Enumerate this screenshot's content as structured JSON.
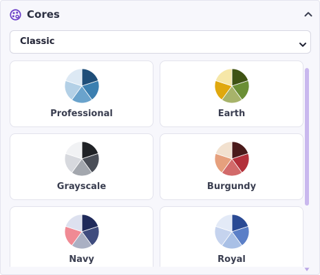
{
  "header": {
    "title": "Cores",
    "icon": "palette-icon",
    "collapse_icon": "chevron-up-icon"
  },
  "theme_select": {
    "value": "Classic",
    "icon": "chevron-down-icon"
  },
  "palettes": [
    {
      "label": "Professional",
      "colors": [
        "#1f4e79",
        "#3b7fb0",
        "#6aa3cc",
        "#b3d0e6",
        "#dde9f4"
      ]
    },
    {
      "label": "Earth",
      "colors": [
        "#3f5314",
        "#6b8f35",
        "#a7b36a",
        "#e0a80e",
        "#f6e7a8"
      ]
    },
    {
      "label": "Grayscale",
      "colors": [
        "#202226",
        "#4a4e57",
        "#a3a7ae",
        "#d7d9de",
        "#f1f2f4"
      ]
    },
    {
      "label": "Burgundy",
      "colors": [
        "#4a1a1a",
        "#b3303a",
        "#d26a6a",
        "#e6a07d",
        "#f2e1cf"
      ]
    },
    {
      "label": "Navy",
      "colors": [
        "#1f2a5a",
        "#3f4c7e",
        "#aab0c3",
        "#f08a94",
        "#dde1ef"
      ]
    },
    {
      "label": "Royal",
      "colors": [
        "#2a4a94",
        "#5b7fc7",
        "#a9c0e6",
        "#c5d3ee",
        "#e3eaf7"
      ]
    }
  ],
  "scrollbar": {
    "thumb_color": "#c9b8ee",
    "arrow_color": "#b9a6e6"
  }
}
